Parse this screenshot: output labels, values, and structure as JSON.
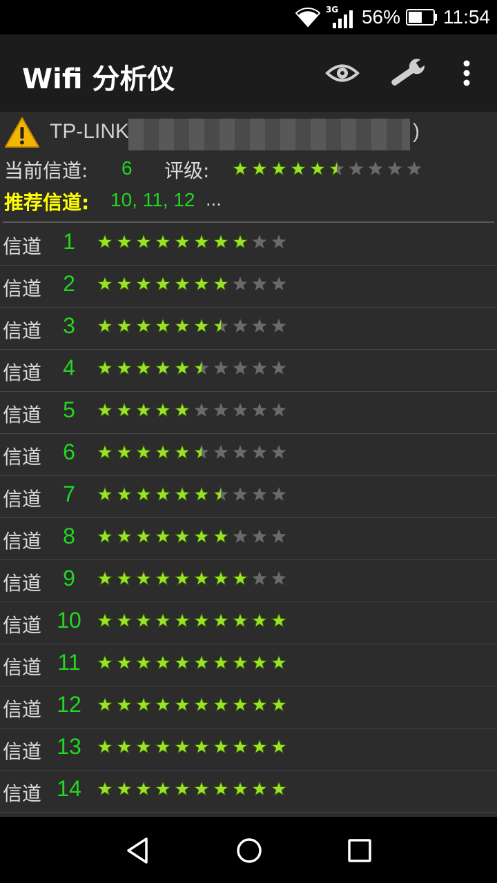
{
  "status_bar": {
    "network_type": "3G",
    "battery_percent": "56%",
    "battery_level": 0.56,
    "time": "11:54",
    "icons": [
      "wifi-icon",
      "cell-signal-icon",
      "battery-icon"
    ]
  },
  "app_bar": {
    "title": "Wifi 分析仪",
    "icons": [
      "eye-icon",
      "wrench-icon",
      "more-vert-icon"
    ]
  },
  "network": {
    "ssid_visible": "TP-LINK",
    "ssid_suffix": ")",
    "warning_icon": "warning-icon"
  },
  "current_channel": {
    "label": "当前信道:",
    "value": "6",
    "rating_label": "评级:",
    "rating": 5.5,
    "max_rating": 10
  },
  "recommended": {
    "label": "推荐信道:",
    "value": "10, 11, 12",
    "more": "..."
  },
  "channel_label": "信道",
  "channels": [
    {
      "number": "1",
      "rating": 8
    },
    {
      "number": "2",
      "rating": 7
    },
    {
      "number": "3",
      "rating": 6.5
    },
    {
      "number": "4",
      "rating": 5.5
    },
    {
      "number": "5",
      "rating": 5
    },
    {
      "number": "6",
      "rating": 5.5
    },
    {
      "number": "7",
      "rating": 6.5
    },
    {
      "number": "8",
      "rating": 7
    },
    {
      "number": "9",
      "rating": 8
    },
    {
      "number": "10",
      "rating": 10
    },
    {
      "number": "11",
      "rating": 10
    },
    {
      "number": "12",
      "rating": 10
    },
    {
      "number": "13",
      "rating": 10
    },
    {
      "number": "14",
      "rating": 10
    }
  ],
  "colors": {
    "green_text": "#22d622",
    "yellow_text": "#ffff00",
    "star_filled": "#9be12a",
    "star_empty": "#6a6a6a"
  },
  "nav_bar": {
    "icons": [
      "back-icon",
      "home-icon",
      "recents-icon"
    ]
  }
}
